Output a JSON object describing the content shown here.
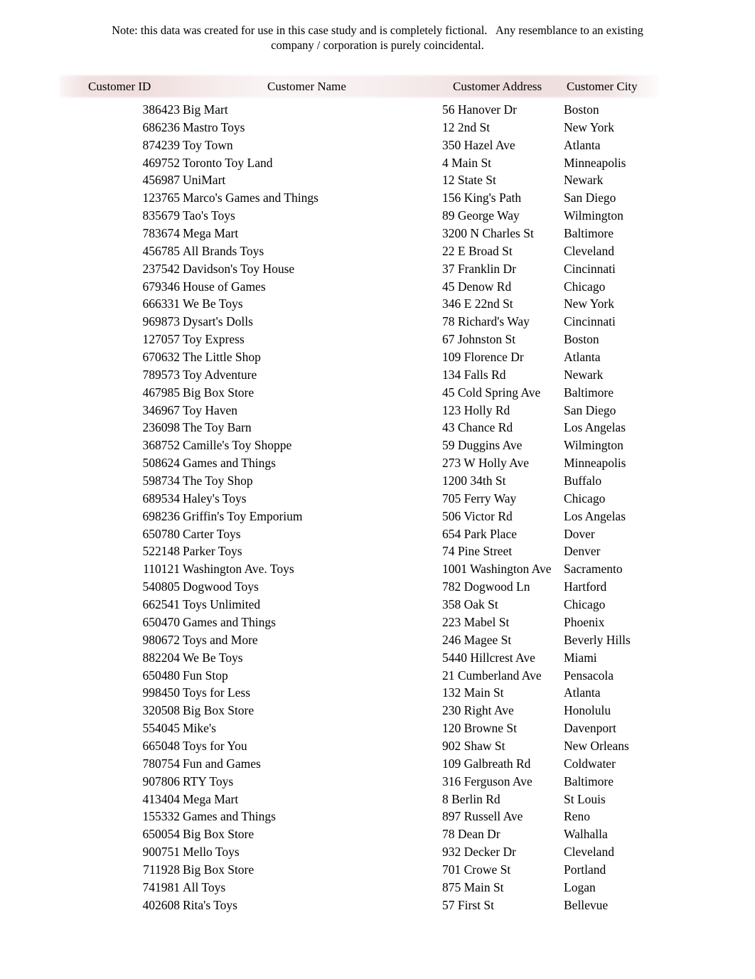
{
  "disclaimer": "Note: this data was created for use in this case study and is completely fictional.   Any resemblance to an existing\ncompany / corporation is purely coincidental.",
  "table": {
    "headers": {
      "customer_id": "Customer ID",
      "customer_name": "Customer Name",
      "customer_address": "Customer Address",
      "customer_city": "Customer City"
    },
    "header_band_color": "#efdede",
    "rows": [
      {
        "id": "386423",
        "name": "Big Mart",
        "address": "56 Hanover Dr",
        "city": "Boston"
      },
      {
        "id": "686236",
        "name": "Mastro Toys",
        "address": "12 2nd St",
        "city": "New York"
      },
      {
        "id": "874239",
        "name": "Toy Town",
        "address": "350 Hazel Ave",
        "city": "Atlanta"
      },
      {
        "id": "469752",
        "name": "Toronto Toy Land",
        "address": "4 Main St",
        "city": "Minneapolis"
      },
      {
        "id": "456987",
        "name": "UniMart",
        "address": "12 State St",
        "city": "Newark"
      },
      {
        "id": "123765",
        "name": "Marco's Games and Things",
        "address": "156 King's Path",
        "city": "San Diego"
      },
      {
        "id": "835679",
        "name": "Tao's Toys",
        "address": "89 George Way",
        "city": "Wilmington"
      },
      {
        "id": "783674",
        "name": "Mega Mart",
        "address": "3200 N Charles St",
        "city": "Baltimore"
      },
      {
        "id": "456785",
        "name": "All Brands Toys",
        "address": "22 E Broad St",
        "city": "Cleveland"
      },
      {
        "id": "237542",
        "name": "Davidson's Toy House",
        "address": "37 Franklin Dr",
        "city": "Cincinnati"
      },
      {
        "id": "679346",
        "name": "House of Games",
        "address": "45 Denow Rd",
        "city": "Chicago"
      },
      {
        "id": "666331",
        "name": "We Be Toys",
        "address": "346 E 22nd St",
        "city": "New York"
      },
      {
        "id": "969873",
        "name": "Dysart's Dolls",
        "address": "78 Richard's Way",
        "city": "Cincinnati"
      },
      {
        "id": "127057",
        "name": "Toy Express",
        "address": "67 Johnston St",
        "city": "Boston"
      },
      {
        "id": "670632",
        "name": "The Little Shop",
        "address": "109 Florence Dr",
        "city": "Atlanta"
      },
      {
        "id": "789573",
        "name": "Toy Adventure",
        "address": "134 Falls Rd",
        "city": "Newark"
      },
      {
        "id": "467985",
        "name": "Big Box Store",
        "address": "45 Cold Spring Ave",
        "city": "Baltimore"
      },
      {
        "id": "346967",
        "name": "Toy Haven",
        "address": "123 Holly Rd",
        "city": "San Diego"
      },
      {
        "id": "236098",
        "name": "The Toy Barn",
        "address": "43 Chance Rd",
        "city": "Los Angelas"
      },
      {
        "id": "368752",
        "name": "Camille's Toy Shoppe",
        "address": "59 Duggins Ave",
        "city": "Wilmington"
      },
      {
        "id": "508624",
        "name": "Games and Things",
        "address": "273 W Holly Ave",
        "city": "Minneapolis"
      },
      {
        "id": "598734",
        "name": "The Toy Shop",
        "address": "1200 34th St",
        "city": "Buffalo"
      },
      {
        "id": "689534",
        "name": "Haley's Toys",
        "address": "705 Ferry Way",
        "city": "Chicago"
      },
      {
        "id": "698236",
        "name": "Griffin's Toy Emporium",
        "address": "506 Victor Rd",
        "city": "Los Angelas"
      },
      {
        "id": "650780",
        "name": "Carter Toys",
        "address": "654 Park Place",
        "city": "Dover"
      },
      {
        "id": "522148",
        "name": "Parker Toys",
        "address": "74 Pine Street",
        "city": "Denver"
      },
      {
        "id": "110121",
        "name": "Washington Ave. Toys",
        "address": "1001 Washington Ave",
        "city": "Sacramento"
      },
      {
        "id": "540805",
        "name": "Dogwood Toys",
        "address": "782 Dogwood Ln",
        "city": "Hartford"
      },
      {
        "id": "662541",
        "name": "Toys Unlimited",
        "address": "358 Oak St",
        "city": "Chicago"
      },
      {
        "id": "650470",
        "name": "Games and Things",
        "address": "223 Mabel St",
        "city": "Phoenix"
      },
      {
        "id": "980672",
        "name": "Toys and More",
        "address": "246 Magee St",
        "city": "Beverly Hills"
      },
      {
        "id": "882204",
        "name": "We Be Toys",
        "address": "5440 Hillcrest Ave",
        "city": "Miami"
      },
      {
        "id": "650480",
        "name": "Fun Stop",
        "address": "21 Cumberland Ave",
        "city": "Pensacola"
      },
      {
        "id": "998450",
        "name": "Toys for Less",
        "address": "132 Main St",
        "city": "Atlanta"
      },
      {
        "id": "320508",
        "name": "Big Box Store",
        "address": "230 Right Ave",
        "city": "Honolulu"
      },
      {
        "id": "554045",
        "name": "Mike's",
        "address": "120 Browne St",
        "city": "Davenport"
      },
      {
        "id": "665048",
        "name": "Toys for You",
        "address": "902 Shaw St",
        "city": "New Orleans"
      },
      {
        "id": "780754",
        "name": "Fun and Games",
        "address": "109 Galbreath Rd",
        "city": "Coldwater"
      },
      {
        "id": "907806",
        "name": "RTY Toys",
        "address": "316 Ferguson Ave",
        "city": "Baltimore"
      },
      {
        "id": "413404",
        "name": "Mega Mart",
        "address": "8 Berlin Rd",
        "city": "St Louis"
      },
      {
        "id": "155332",
        "name": "Games and Things",
        "address": "897 Russell Ave",
        "city": "Reno"
      },
      {
        "id": "650054",
        "name": "Big Box Store",
        "address": "78 Dean Dr",
        "city": "Walhalla"
      },
      {
        "id": "900751",
        "name": "Mello Toys",
        "address": "932 Decker Dr",
        "city": "Cleveland"
      },
      {
        "id": "711928",
        "name": "Big Box Store",
        "address": "701 Crowe St",
        "city": "Portland"
      },
      {
        "id": "741981",
        "name": "All Toys",
        "address": "875 Main St",
        "city": "Logan"
      },
      {
        "id": "402608",
        "name": "Rita's Toys",
        "address": "57 First St",
        "city": "Bellevue"
      }
    ]
  }
}
